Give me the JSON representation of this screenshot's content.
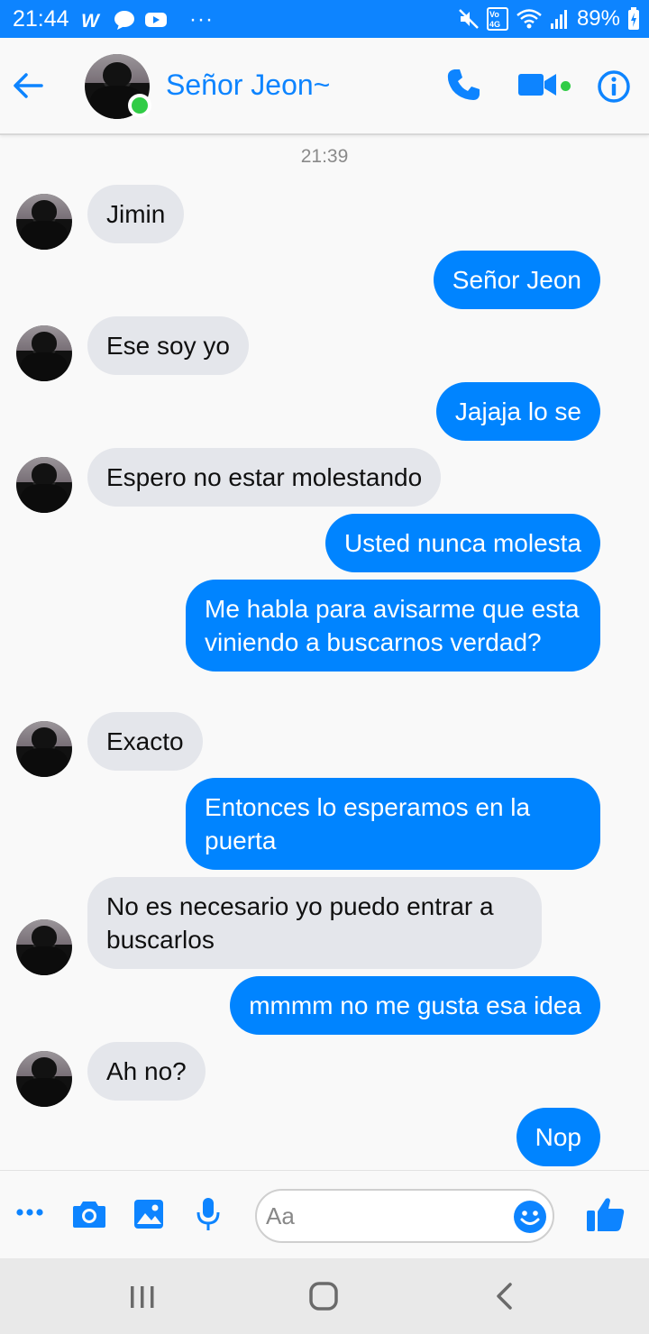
{
  "status_bar": {
    "time": "21:44",
    "overflow": "···",
    "battery_percent": "89%",
    "icons": [
      "w-icon",
      "chat-bubble-icon",
      "youtube-icon",
      "mute-icon",
      "volte-4g-icon",
      "wifi-icon",
      "signal-icon",
      "battery-charging-icon"
    ]
  },
  "header": {
    "contact_name": "Señor Jeon~",
    "online": true,
    "icons": [
      "back-arrow-icon",
      "phone-icon",
      "video-camera-icon",
      "info-icon"
    ]
  },
  "chat": {
    "timestamp": "21:39",
    "messages": [
      {
        "dir": "in",
        "text": "Jimin"
      },
      {
        "dir": "out",
        "text": "Señor Jeon"
      },
      {
        "dir": "in",
        "text": "Ese soy yo"
      },
      {
        "dir": "out",
        "text": "Jajaja lo se"
      },
      {
        "dir": "in",
        "text": "Espero no estar molestando"
      },
      {
        "dir": "out",
        "text": "Usted nunca molesta"
      },
      {
        "dir": "out",
        "text": "Me habla para avisarme que esta viniendo a buscarnos verdad?"
      },
      {
        "dir": "in",
        "text": "Exacto"
      },
      {
        "dir": "out",
        "text": "Entonces lo esperamos en la puerta"
      },
      {
        "dir": "in",
        "text": "No es necesario yo puedo entrar a buscarlos"
      },
      {
        "dir": "out",
        "text": "mmmm no me gusta esa idea"
      },
      {
        "dir": "in",
        "text": "Ah no?"
      },
      {
        "dir": "out",
        "text": "Nop"
      }
    ]
  },
  "composer": {
    "placeholder": "Aa",
    "value": "",
    "icons": [
      "more-icon",
      "camera-icon",
      "image-icon",
      "microphone-icon",
      "emoji-icon",
      "thumbs-up-icon"
    ]
  },
  "nav_bar": {
    "icons": [
      "recent-apps-icon",
      "home-icon",
      "back-icon"
    ]
  },
  "colors": {
    "accent": "#0084ff",
    "status_bar": "#0d84ff",
    "incoming_bubble": "#e4e6eb",
    "online": "#31cc46"
  }
}
